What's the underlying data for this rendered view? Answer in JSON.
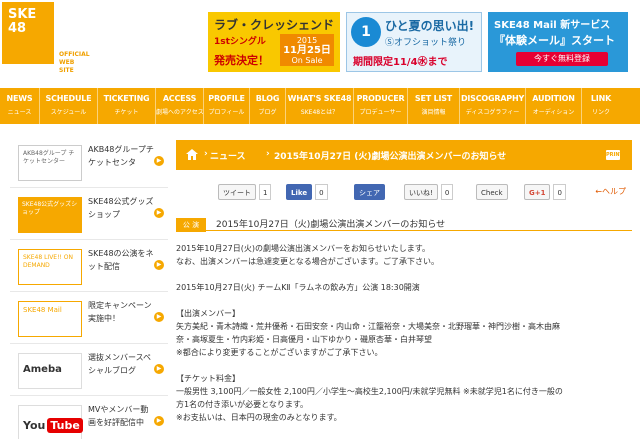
{
  "logo": {
    "text1": "SKE",
    "text2": "48",
    "official": "OFFICIAL",
    "website": "WEB SITE"
  },
  "banners": {
    "love": {
      "title": "ラブ・クレッシェンド",
      "line2": "1stシングル",
      "line3": "発売決定！",
      "date_year": "2015",
      "date_day": "11月25日",
      "date_note": "On Sale"
    },
    "natsu": {
      "num": "1",
      "title": "ひと夏の思い出!",
      "sub": "Ⓢオフショット祭り",
      "period": "期間限定11/4㊌まで"
    },
    "mail": {
      "title": "SKE48 Mail 新サービス",
      "sub": "『体験メール』スタート",
      "button": "今すぐ無料登録"
    }
  },
  "nav": [
    {
      "en": "NEWS",
      "ja": "ニュース"
    },
    {
      "en": "SCHEDULE",
      "ja": "スケジュール"
    },
    {
      "en": "TICKETING",
      "ja": "チケット"
    },
    {
      "en": "ACCESS",
      "ja": "劇場へのアクセス"
    },
    {
      "en": "PROFILE",
      "ja": "プロフィール"
    },
    {
      "en": "BLOG",
      "ja": "ブログ"
    },
    {
      "en": "WHAT'S SKE48",
      "ja": "SKE48とは？"
    },
    {
      "en": "PRODUCER",
      "ja": "プロデューサー"
    },
    {
      "en": "SET LIST",
      "ja": "演目情報"
    },
    {
      "en": "DISCOGRAPHY",
      "ja": "ディスコグラフィー"
    },
    {
      "en": "AUDITION",
      "ja": "オーディション"
    },
    {
      "en": "LINK",
      "ja": "リンク"
    }
  ],
  "sidebar": [
    {
      "thumb": "AKB48グループ チケットセンター",
      "label": "AKB48グループチケットセンタ"
    },
    {
      "thumb": "SKE48公式グッズショップ",
      "label": "SKE48公式グッズショップ"
    },
    {
      "thumb": "SKE48 LIVE!! ON DEMAND",
      "label": "SKE48の公演をネット配信"
    },
    {
      "thumb": "SKE48 Mail",
      "label": "限定キャンペーン実施中！"
    },
    {
      "thumb": "Ameba",
      "label": "選抜メンバースペシャルブログ"
    },
    {
      "thumb": "YouTube",
      "label": "MVやメンバー動画を好評配信中"
    }
  ],
  "crumb": {
    "section": "ニュース",
    "title": "2015年10月27日 (火)劇場公演出演メンバーのお知らせ",
    "print": "PRINT"
  },
  "share": {
    "tweet": "ツイート",
    "tweet_count": "1",
    "like": "Like",
    "like_count": "0",
    "fb_share": "シェア",
    "iine": "いいね!",
    "iine_count": "0",
    "check": "Check",
    "gplus": "G+1",
    "gplus_count": "0",
    "help": "←ヘルプ"
  },
  "article": {
    "tag": "公 演",
    "title": "2015年10月27日（火)劇場公演出演メンバーのお知らせ",
    "intro1": "2015年10月27日(火)の劇場公演出演メンバーをお知らせいたします。",
    "intro2": "なお、出演メンバーは急遽変更となる場合がございます。ご了承下さい。",
    "show": "2015年10月27日(火) チームKⅡ「ラムネの飲み方」公演 18:30開演",
    "members_head": "【出演メンバー】",
    "members1": "矢方美紀・青木詩織・荒井優希・石田安奈・内山命・江籠裕奈・大場美奈・北野瑠華・神門沙樹・高木由麻",
    "members2": "奈・高塚夏生・竹内彩姫・日高優月・山下ゆかり・磯原杏華・白井琴望",
    "members_note": "※都合により変更することがございますがご了承下さい。",
    "ticket_head": "【チケット料金】",
    "ticket1": "一般男性 3,100円／一般女性 2,100円／小学生〜高校生2,100円/未就学児無料 ※未就学児1名に付き一般の",
    "ticket2": "方1名の付き添いが必要となります。",
    "ticket3": "※お支払いは、日本円の現金のみとなります。"
  }
}
